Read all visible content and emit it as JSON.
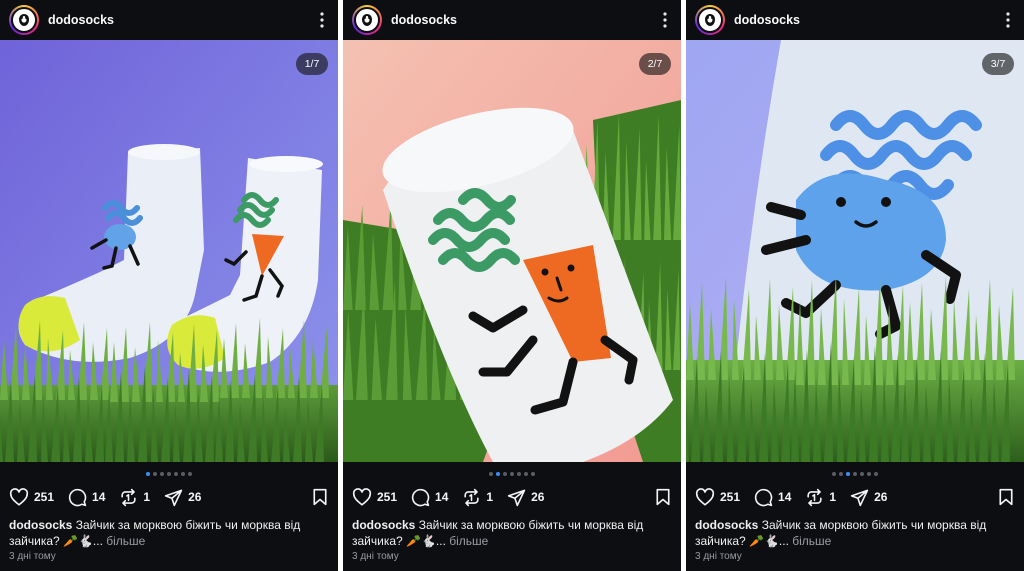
{
  "accent_color": "#3a8df6",
  "background_color": "#0d0e12",
  "posts": [
    {
      "username": "dodosocks",
      "counter": "1/7",
      "slide_index": 1,
      "slide_total": 7,
      "likes": "251",
      "comments": "14",
      "reposts": "1",
      "shares": "26",
      "caption_user": "dodosocks",
      "caption_text": " Зайчик за морквою біжить чи морква від зайчика? 🥕🐇...",
      "more_label": " більше",
      "time": "3 дні тому",
      "image": "two white socks with bunny and carrot pattern standing in grass on purple background"
    },
    {
      "username": "dodosocks",
      "counter": "2/7",
      "slide_index": 2,
      "slide_total": 7,
      "likes": "251",
      "comments": "14",
      "reposts": "1",
      "shares": "26",
      "caption_user": "dodosocks",
      "caption_text": " Зайчик за морквою біжить чи морква від зайчика? 🥕🐇...",
      "more_label": " більше",
      "time": "3 дні тому",
      "image": "close-up of sock with running carrot character on grass and pink background"
    },
    {
      "username": "dodosocks",
      "counter": "3/7",
      "slide_index": 3,
      "slide_total": 7,
      "likes": "251",
      "comments": "14",
      "reposts": "1",
      "shares": "26",
      "caption_user": "dodosocks",
      "caption_text": " Зайчик за морквою біжить чи морква від зайчика? 🥕🐇...",
      "more_label": " більше",
      "time": "3 дні тому",
      "image": "close-up of sock with running blue bunny character above grass on lilac background"
    }
  ],
  "icons": [
    "dodo-logo-icon",
    "more-icon",
    "heart-icon",
    "comment-icon",
    "repost-icon",
    "share-icon",
    "bookmark-icon"
  ]
}
